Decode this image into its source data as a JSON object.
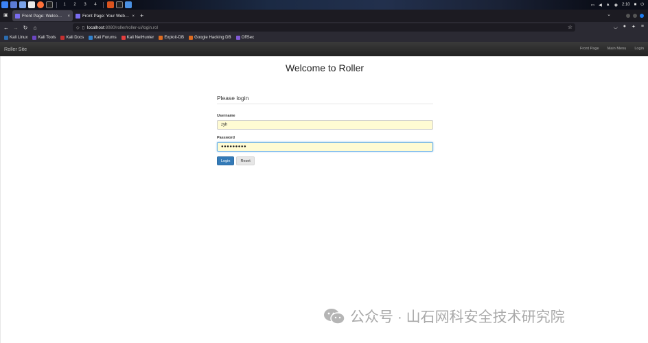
{
  "os_taskbar": {
    "workspaces": [
      "1",
      "2",
      "3",
      "4"
    ],
    "clock": "2:10"
  },
  "browser": {
    "tabs": [
      {
        "title": "Front Page: Welcome to R",
        "close": "×"
      },
      {
        "title": "Front Page: Your Weblog",
        "close": "×"
      }
    ],
    "new_tab": "+",
    "url_host": "localhost",
    "url_rest": ":8080/roller/roller-ui/login.rol",
    "bookmarks": [
      {
        "label": "Kali Linux",
        "color": "#2b6cb0"
      },
      {
        "label": "Kali Tools",
        "color": "#6b46c1"
      },
      {
        "label": "Kali Docs",
        "color": "#c53030"
      },
      {
        "label": "Kali Forums",
        "color": "#3182ce"
      },
      {
        "label": "Kali NetHunter",
        "color": "#e53e3e"
      },
      {
        "label": "Exploit-DB",
        "color": "#dd6b20"
      },
      {
        "label": "Google Hacking DB",
        "color": "#dd6b20"
      },
      {
        "label": "OffSec",
        "color": "#805ad5"
      }
    ]
  },
  "site": {
    "brand": "Roller Site",
    "nav_links": [
      "Front Page",
      "Main Menu",
      "Login"
    ],
    "title": "Welcome to Roller"
  },
  "login_form": {
    "legend": "Please login",
    "username_label": "Username",
    "username_value": "zyh",
    "password_label": "Password",
    "password_value": "●●●●●●●●●",
    "login_button": "Login",
    "reset_button": "Reset"
  },
  "watermark": {
    "text": "公众号 · 山石网科安全技术研究院"
  },
  "colors": {
    "primary_button": "#337ab7",
    "autofill": "#fffbd3"
  }
}
